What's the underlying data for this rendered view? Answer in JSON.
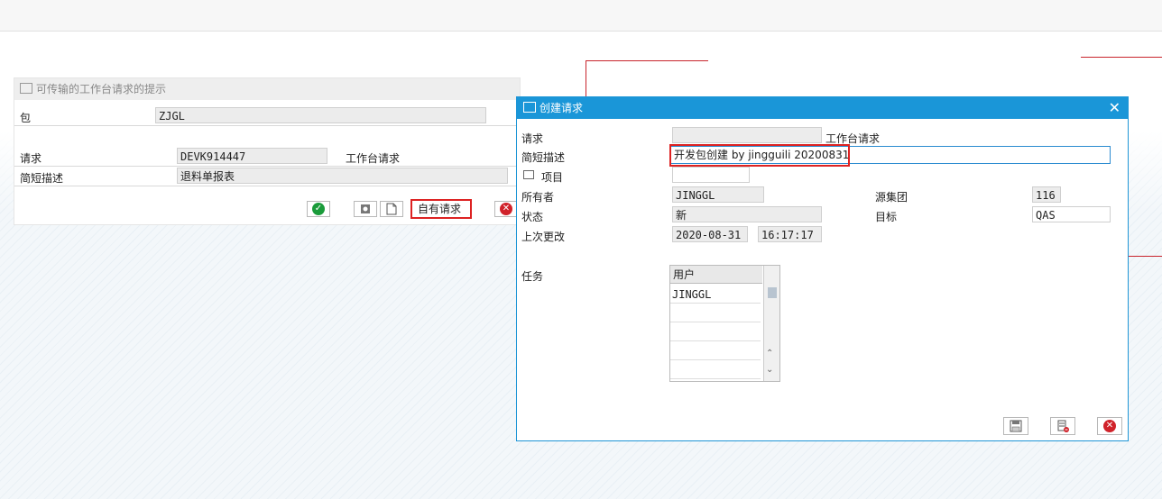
{
  "dialog1": {
    "title": "可传输的工作台请求的提示",
    "package_label": "包",
    "package_value": "ZJGL",
    "request_label": "请求",
    "request_value": "DEVK914447",
    "request_type": "工作台请求",
    "short_desc_label": "简短描述",
    "short_desc_value": "退料单报表",
    "own_requests_label": "自有请求"
  },
  "dialog2": {
    "title": "创建请求",
    "request_label": "请求",
    "request_value": "",
    "request_type": "工作台请求",
    "short_desc_label": "简短描述",
    "short_desc_value": "开发包创建 by jingguili 20200831",
    "project_label": "项目",
    "project_value": "",
    "owner_label": "所有者",
    "owner_value": "JINGGL",
    "source_client_label": "源集团",
    "source_client_value": "116",
    "status_label": "状态",
    "status_value": "新",
    "target_label": "目标",
    "target_value": "QAS",
    "last_changed_label": "上次更改",
    "last_changed_date": "2020-08-31",
    "last_changed_time": "16:17:17",
    "tasks_label": "任务",
    "tasks_table": {
      "header": "用户",
      "rows": [
        "JINGGL",
        "",
        "",
        "",
        ""
      ]
    }
  },
  "icons": {
    "confirm": "check-circle-icon",
    "cancel": "cancel-circle-icon",
    "save": "save-icon",
    "delete": "delete-icon"
  },
  "colors": {
    "dialog_title_bg": "#1a96d8",
    "highlight": "#d22222",
    "confirm": "#1a9b3a",
    "cancel": "#d0222a"
  }
}
